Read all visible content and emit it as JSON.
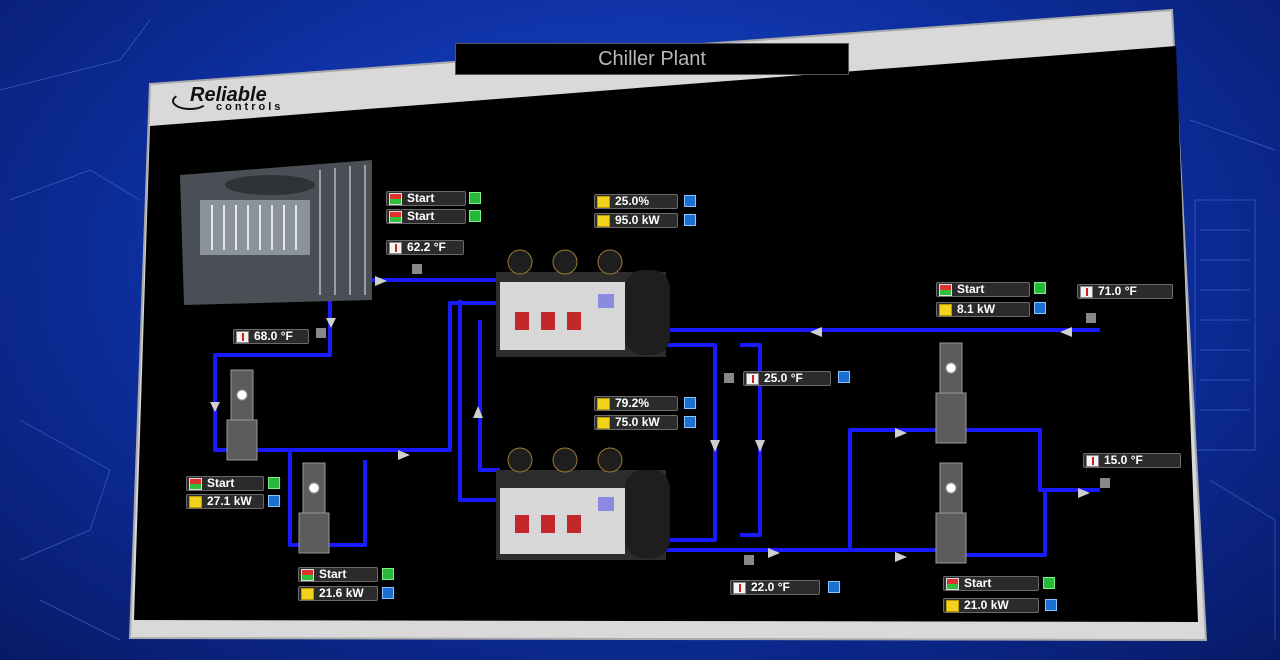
{
  "app": {
    "title": "Chiller Plant",
    "brand": {
      "name": "Reliable",
      "sub": "controls"
    }
  },
  "colors": {
    "pipe": "#1a1aff",
    "background": "#000000",
    "frame": "#d9d9d9",
    "status_green": "#27b83a",
    "status_blue": "#1b6fd0"
  },
  "icons": {
    "start": "start-stop-icon",
    "power": "power-meter-icon",
    "temperature": "thermometer-icon",
    "override": "override-icon"
  },
  "cooling_tower": {
    "fan1": "Start",
    "fan2": "Start",
    "leaving_temp": "62.2 °F",
    "return_temp": "68.0 °F"
  },
  "chiller_1": {
    "load": "25.0%",
    "power": "95.0 kW"
  },
  "chiller_2": {
    "load": "79.2%",
    "power": "75.0 kW"
  },
  "condenser_pump_1": {
    "status": "Start",
    "power": "27.1 kW"
  },
  "condenser_pump_2": {
    "status": "Start",
    "power": "21.6 kW"
  },
  "chilled_water_pump_1": {
    "status": "Start",
    "power": "8.1 kW"
  },
  "chilled_water_pump_2": {
    "status": "Start",
    "power": "21.0 kW"
  },
  "sensors": {
    "chw_return": "71.0 °F",
    "chw_supply_mid": "25.0 °F",
    "chw_supply_bottom": "22.0 °F",
    "chw_loop": "15.0 °F"
  }
}
